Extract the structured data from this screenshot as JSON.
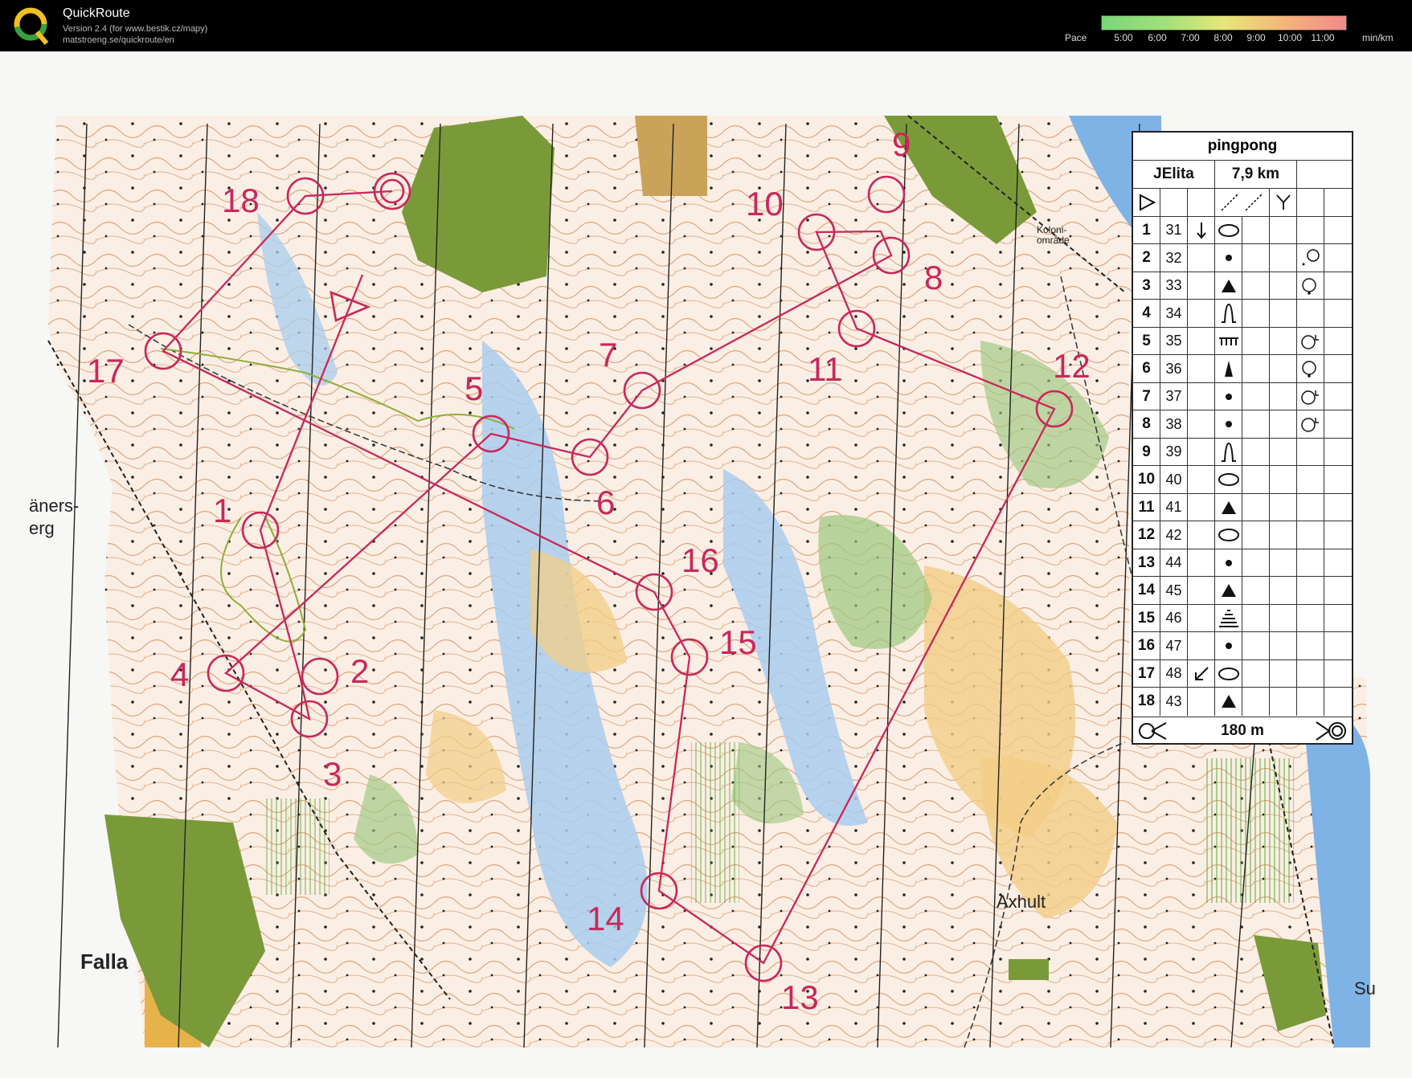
{
  "app": {
    "title": "QuickRoute",
    "version_line": "Version 2.4  (for www.bestik.cz/mapy)",
    "url_line": "matstroeng.se/quickroute/en",
    "pace_label": "Pace",
    "pace_unit": "min/km",
    "pace_ticks": [
      "5:00",
      "6:00",
      "7:00",
      "8:00",
      "9:00",
      "10:00",
      "11:00"
    ]
  },
  "course": {
    "name": "pingpong",
    "class": "JElita",
    "length": "7,9 km",
    "finish_distance": "180 m",
    "controls": [
      {
        "n": "1",
        "code": "31",
        "symbol": "ellipse",
        "extra": "arrow-down"
      },
      {
        "n": "2",
        "code": "32",
        "symbol": "dot",
        "extra": "circle-small"
      },
      {
        "n": "3",
        "code": "33",
        "symbol": "triangle",
        "extra": "circle-dot"
      },
      {
        "n": "4",
        "code": "34",
        "symbol": "knoll",
        "extra": ""
      },
      {
        "n": "5",
        "code": "35",
        "symbol": "comb",
        "extra": "circle-L"
      },
      {
        "n": "6",
        "code": "36",
        "symbol": "spike",
        "extra": "circle-dot"
      },
      {
        "n": "7",
        "code": "37",
        "symbol": "dot",
        "extra": "circle-L"
      },
      {
        "n": "8",
        "code": "38",
        "symbol": "dot",
        "extra": "circle-L"
      },
      {
        "n": "9",
        "code": "39",
        "symbol": "knoll",
        "extra": ""
      },
      {
        "n": "10",
        "code": "40",
        "symbol": "ellipse",
        "extra": ""
      },
      {
        "n": "11",
        "code": "41",
        "symbol": "triangle",
        "extra": ""
      },
      {
        "n": "12",
        "code": "42",
        "symbol": "ellipse",
        "extra": ""
      },
      {
        "n": "13",
        "code": "44",
        "symbol": "dot",
        "extra": ""
      },
      {
        "n": "14",
        "code": "45",
        "symbol": "triangle",
        "extra": ""
      },
      {
        "n": "15",
        "code": "46",
        "symbol": "stack",
        "extra": ""
      },
      {
        "n": "16",
        "code": "47",
        "symbol": "dot",
        "extra": ""
      },
      {
        "n": "17",
        "code": "48",
        "symbol": "ellipse",
        "extra": "arrow-sw"
      },
      {
        "n": "18",
        "code": "43",
        "symbol": "triangle",
        "extra": ""
      }
    ]
  },
  "map": {
    "place_names": [
      "Falla",
      "Axhult",
      "Koloni-\nområde",
      "äners-\nerg",
      "Su"
    ],
    "control_labels": [
      "1",
      "2",
      "3",
      "4",
      "5",
      "6",
      "7",
      "8",
      "9",
      "10",
      "11",
      "12",
      "13",
      "14",
      "15",
      "16",
      "17",
      "18"
    ],
    "colors": {
      "course": "#c8285a",
      "water": "#a9cdee",
      "open": "#f2cd86",
      "forest_green": "#9cc77f",
      "contour": "#c0692a"
    }
  }
}
